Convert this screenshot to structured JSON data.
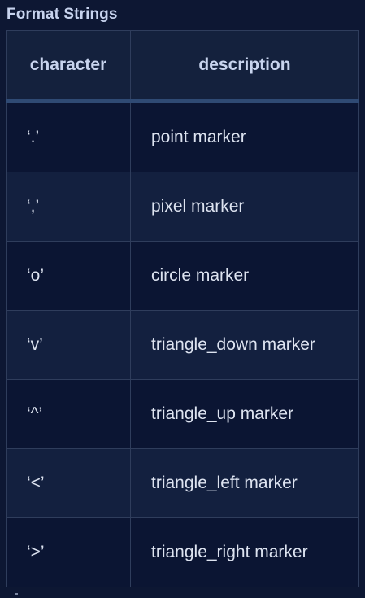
{
  "caption": "Format Strings",
  "table": {
    "headers": [
      "character",
      "description"
    ],
    "rows": [
      {
        "character": "‘.’",
        "description": "point marker"
      },
      {
        "character": "‘,’",
        "description": "pixel marker"
      },
      {
        "character": "‘o’",
        "description": "circle marker"
      },
      {
        "character": "‘v’",
        "description": "triangle_down marker"
      },
      {
        "character": "‘^’",
        "description": "triangle_up marker"
      },
      {
        "character": "‘<’",
        "description": "triangle_left marker"
      },
      {
        "character": "‘>’",
        "description": "triangle_right marker"
      }
    ]
  }
}
